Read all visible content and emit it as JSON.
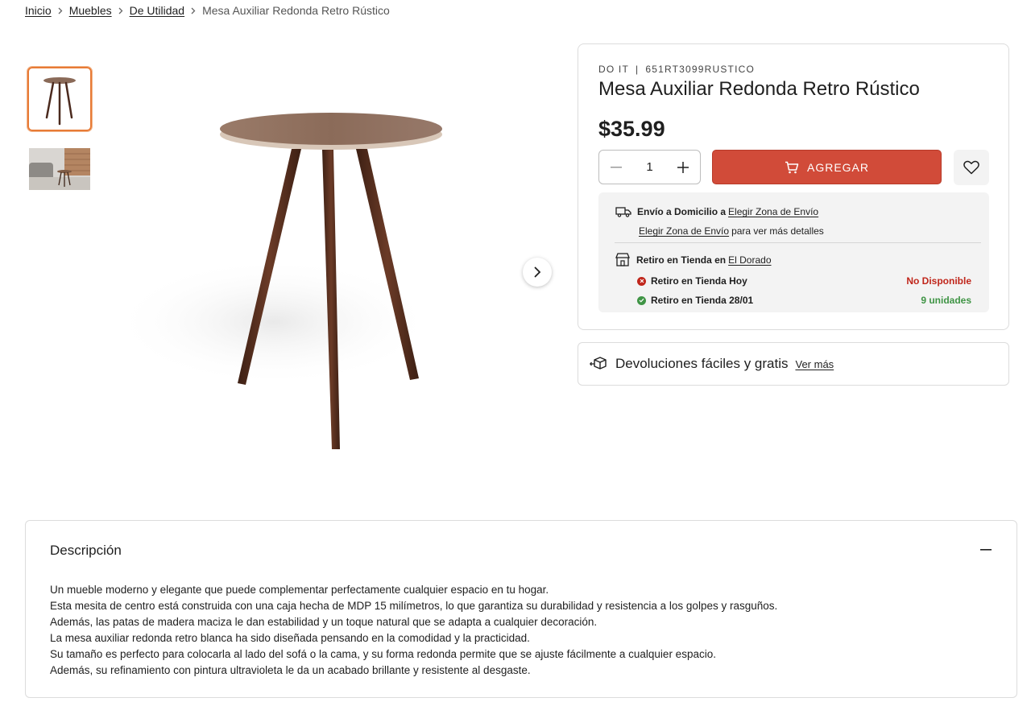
{
  "breadcrumb": {
    "items": [
      "Inicio",
      "Muebles",
      "De Utilidad"
    ],
    "current": "Mesa Auxiliar Redonda Retro Rústico"
  },
  "gallery": {
    "thumbnails": [
      "table-front-icon",
      "table-room-photo"
    ]
  },
  "product": {
    "brand": "DO IT",
    "separator": "|",
    "sku": "651RT3099RUSTICO",
    "title": "Mesa Auxiliar Redonda Retro Rústico",
    "price": "$35.99",
    "quantity": "1",
    "add_label": "AGREGAR"
  },
  "delivery": {
    "home_label": "Envío a Domicilio a",
    "zone_link": "Elegir Zona de Envío",
    "zone_link_2": "Elegir Zona de Envío",
    "zone_hint": "para ver más detalles",
    "pickup_label": "Retiro en Tienda en",
    "store_link": "El Dorado",
    "pickup_rows": [
      {
        "label": "Retiro en Tienda Hoy",
        "status": "No Disponible"
      },
      {
        "label": "Retiro en Tienda 28/01",
        "status": "9 unidades"
      }
    ]
  },
  "returns": {
    "title": "Devoluciones fáciles y gratis",
    "link": "Ver más"
  },
  "description": {
    "title": "Descripción",
    "lines": [
      "Un mueble moderno y elegante que puede complementar perfectamente cualquier espacio en tu hogar.",
      "Esta mesita de centro está construida con una caja hecha de MDP 15 milímetros, lo que garantiza su durabilidad y resistencia a los golpes y rasguños.",
      "Además, las patas de madera maciza le dan estabilidad y un toque natural que se adapta a cualquier decoración.",
      "La mesa auxiliar redonda retro blanca ha sido diseñada pensando en la comodidad y la practicidad.",
      "Su tamaño es perfecto para colocarla al lado del sofá o la cama, y su forma redonda permite que se ajuste fácilmente a cualquier espacio.",
      "Además, su refinamiento con pintura ultravioleta le da un acabado brillante y resistente al desgaste."
    ]
  },
  "colors": {
    "accent": "#d14b39",
    "thumb_border": "#e87b36",
    "unavailable": "#c0261b",
    "available": "#3f9445"
  }
}
